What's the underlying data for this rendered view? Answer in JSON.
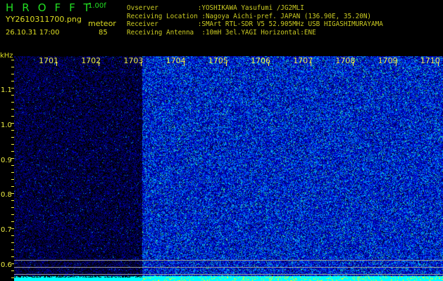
{
  "header": {
    "title": "HROFFT",
    "version": "1.00f",
    "filename": "YY2610311700.png",
    "datetime": "26.10.31 17:00",
    "mode": "meteor",
    "count": "85"
  },
  "info": [
    "Ovserver          :YOSHIKAWA Yasufumi /JG2MLI",
    "Receiving Location :Nagoya Aichi-pref. JAPAN (136.90E, 35.20N)",
    "Receiver          :SMArt RTL-SDR V5 52.905MHz USB HIGASHIMURAYAMA",
    "Receiving Antenna  :10mH 3el.YAGI Horizontal:ENE"
  ],
  "yaxis": {
    "unit": "kHz",
    "labels": [
      "1.1",
      "1.0",
      "0.9",
      "0.8",
      "0.7",
      "0.6"
    ]
  },
  "xaxis": {
    "labels": [
      "1701",
      "1702",
      "1703",
      "1704",
      "1705",
      "1706",
      "1707",
      "1708",
      "1709",
      "1710"
    ]
  },
  "colors": {
    "header_green": "#22dd22",
    "text_yellow": "#dddd22",
    "noise_low": "#0000a0",
    "noise_high": "#00ffff",
    "level_bar": "#00ffff",
    "spike": "#ffff00"
  }
}
